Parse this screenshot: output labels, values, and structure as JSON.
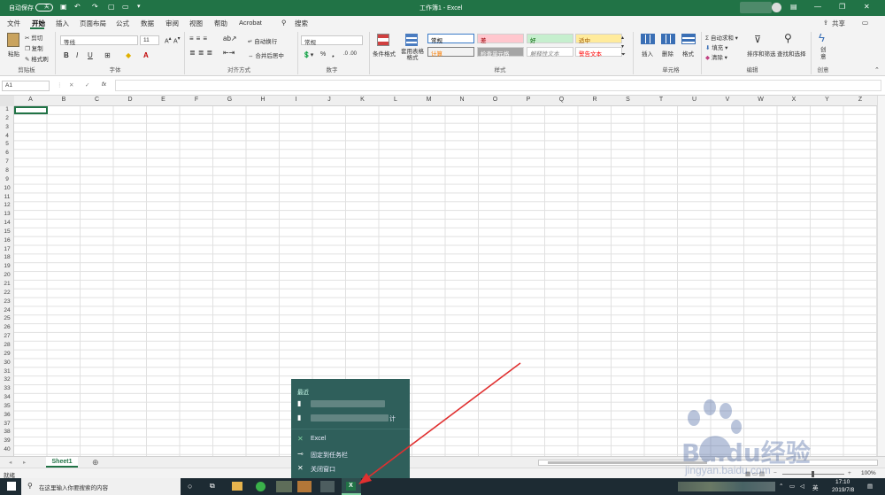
{
  "titlebar": {
    "autosave_label": "自动保存",
    "autosave_state": "关",
    "doc_title": "工作簿1 - Excel"
  },
  "tabs": [
    "文件",
    "开始",
    "插入",
    "页面布局",
    "公式",
    "数据",
    "审阅",
    "视图",
    "帮助",
    "Acrobat"
  ],
  "active_tab": "开始",
  "search_placeholder": "搜索",
  "share_label": "共享",
  "ribbon": {
    "clipboard": {
      "paste": "粘贴",
      "cut": "剪切",
      "copy": "复制",
      "format_painter": "格式刷",
      "group": "剪贴板"
    },
    "font": {
      "name": "等线",
      "size": "11",
      "group": "字体"
    },
    "alignment": {
      "wrap": "自动换行",
      "merge": "合并后居中",
      "group": "对齐方式"
    },
    "number": {
      "format": "常规",
      "group": "数字"
    },
    "styles": {
      "conditional": "条件格式",
      "table": "套用表格格式",
      "cells": [
        {
          "label": "常规",
          "bg": "#ffffff",
          "fg": "#000000",
          "border": "#3b7bc8"
        },
        {
          "label": "差",
          "bg": "#ffc7ce",
          "fg": "#9c0006"
        },
        {
          "label": "好",
          "bg": "#c6efce",
          "fg": "#006100"
        },
        {
          "label": "适中",
          "bg": "#ffeb9c",
          "fg": "#9c5700"
        },
        {
          "label": "计算",
          "bg": "#f2f2f2",
          "fg": "#fa7d00",
          "border": "#7f7f7f"
        },
        {
          "label": "检查单元格",
          "bg": "#a5a5a5",
          "fg": "#ffffff"
        },
        {
          "label": "解释性文本",
          "bg": "#ffffff",
          "fg": "#7f7f7f",
          "italic": true
        },
        {
          "label": "警告文本",
          "bg": "#ffffff",
          "fg": "#ff0000"
        }
      ],
      "group": "样式"
    },
    "cells": {
      "insert": "插入",
      "delete": "删除",
      "format": "格式",
      "group": "单元格"
    },
    "editing": {
      "autosum": "自动求和",
      "fill": "填充",
      "clear": "清除",
      "sort": "排序和筛选",
      "find": "查找和选择",
      "group": "编辑"
    },
    "creative": {
      "label": "创意",
      "group": "创意"
    }
  },
  "formula_bar": {
    "name_box": "A1",
    "fx": "fx",
    "cancel": "✕",
    "enter": "✓"
  },
  "columns": [
    "A",
    "B",
    "C",
    "D",
    "E",
    "F",
    "G",
    "H",
    "I",
    "J",
    "K",
    "L",
    "M",
    "N",
    "O",
    "P",
    "Q",
    "R",
    "S",
    "T",
    "U",
    "V",
    "W",
    "X",
    "Y",
    "Z"
  ],
  "rows": [
    "1",
    "2",
    "3",
    "4",
    "5",
    "6",
    "7",
    "8",
    "9",
    "10",
    "11",
    "12",
    "13",
    "14",
    "15",
    "16",
    "17",
    "18",
    "19",
    "20",
    "21",
    "22",
    "23",
    "24",
    "25",
    "26",
    "27",
    "28",
    "29",
    "30",
    "31",
    "32",
    "33",
    "34",
    "35",
    "36",
    "37",
    "38",
    "39",
    "40"
  ],
  "sheet_tab": "Sheet1",
  "status": "就绪",
  "zoom": "100%",
  "jump_list": {
    "recent_header": "最近",
    "recent_suffix": "计",
    "app_name": "Excel",
    "pin": "固定到任务栏",
    "close": "关闭窗口"
  },
  "taskbar": {
    "search_placeholder": "在这里输入你要搜索的内容",
    "ime": "英",
    "time": "17:10",
    "date": "2019/7/8"
  },
  "watermark": {
    "text": "Baidu经验",
    "url": "jingyan.baidu.com"
  },
  "colors": {
    "excel_green": "#217346",
    "taskbar": "#1d2b33",
    "jump_bg": "#2f5f5b",
    "arrow": "#e03030"
  }
}
